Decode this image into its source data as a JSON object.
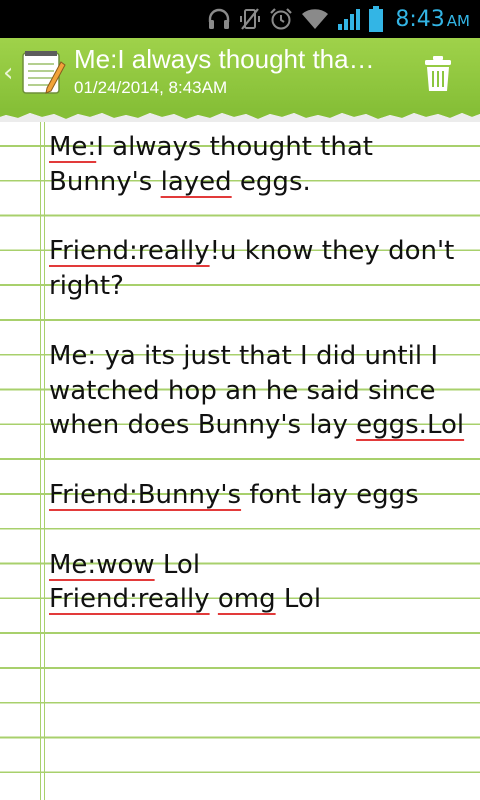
{
  "status_bar": {
    "time": "8:43",
    "am_pm": "AM",
    "icons": [
      "headphones-icon",
      "vibrate-off-icon",
      "alarm-icon",
      "wifi-icon",
      "signal-icon",
      "battery-icon"
    ]
  },
  "action_bar": {
    "title": "Me:I always thought tha…",
    "subtitle": "01/24/2014, 8:43AM",
    "back_icon": "chevron-left-icon",
    "app_icon": "notepad-icon",
    "delete_icon": "trash-icon",
    "color": "#8cc63f"
  },
  "note": {
    "paragraphs": [
      [
        {
          "text": "Me:",
          "spell": true
        },
        {
          "text": "I always thought that Bunny's ",
          "spell": false
        },
        {
          "text": "layed",
          "spell": true
        },
        {
          "text": " eggs.",
          "spell": false
        }
      ],
      [],
      [
        {
          "text": "Friend:really",
          "spell": true
        },
        {
          "text": "!u know they don't right?",
          "spell": false
        }
      ],
      [],
      [
        {
          "text": "Me: ya its just that I did until I watched hop an he said since when does Bunny's lay ",
          "spell": false
        },
        {
          "text": "eggs.Lol",
          "spell": true
        }
      ],
      [],
      [
        {
          "text": "Friend:Bunny's",
          "spell": true
        },
        {
          "text": " font lay eggs",
          "spell": false
        }
      ],
      [],
      [
        {
          "text": "Me:wow",
          "spell": true
        },
        {
          "text": " Lol",
          "spell": false
        }
      ],
      [
        {
          "text": "Friend:really",
          "spell": true
        },
        {
          "text": " ",
          "spell": false
        },
        {
          "text": "omg",
          "spell": true
        },
        {
          "text": " Lol",
          "spell": false
        }
      ]
    ],
    "line_color": "#a8d06c",
    "spellcheck_color": "#e23a3a"
  }
}
